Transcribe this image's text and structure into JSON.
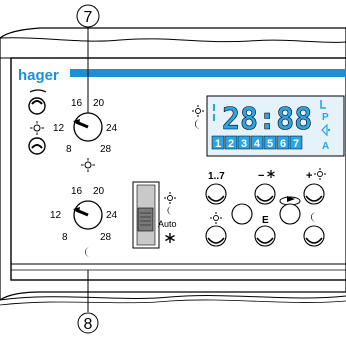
{
  "callouts": {
    "top": "7",
    "bottom": "8"
  },
  "brand": {
    "name": "hager",
    "color": "#1e8fd6"
  },
  "dial_top": {
    "labels": [
      "16",
      "20",
      "24",
      "28",
      "8",
      "12"
    ],
    "symbol_icon": "sun-icon"
  },
  "dial_bottom": {
    "labels": [
      "16",
      "20",
      "24",
      "28",
      "8",
      "12"
    ],
    "symbol_icon": "moon-icon"
  },
  "left_icons": [
    "sun-icon",
    "moon-icon"
  ],
  "display": {
    "time": "28:88",
    "days": [
      "1",
      "2",
      "3",
      "4",
      "5",
      "6",
      "7"
    ],
    "side_letters": [
      "L",
      "P",
      "A"
    ],
    "side_icons": [
      "pointer-icon",
      "bell-icon"
    ],
    "left_icons": [
      "sun-icon",
      "moon-icon"
    ],
    "color": "#2ba3e4",
    "bg": "#e6f2fa"
  },
  "mode_switch": {
    "labels": [
      "Auto"
    ],
    "icons": [
      "sun-icon",
      "moon-icon",
      "snowflake-icon"
    ]
  },
  "buttons": {
    "days_label": "1..7",
    "minus_label": "−",
    "plus_label": "+",
    "e_label": "E",
    "icons": [
      "snowflake-icon",
      "sun-icon",
      "arrow-icon",
      "moon-icon"
    ]
  }
}
